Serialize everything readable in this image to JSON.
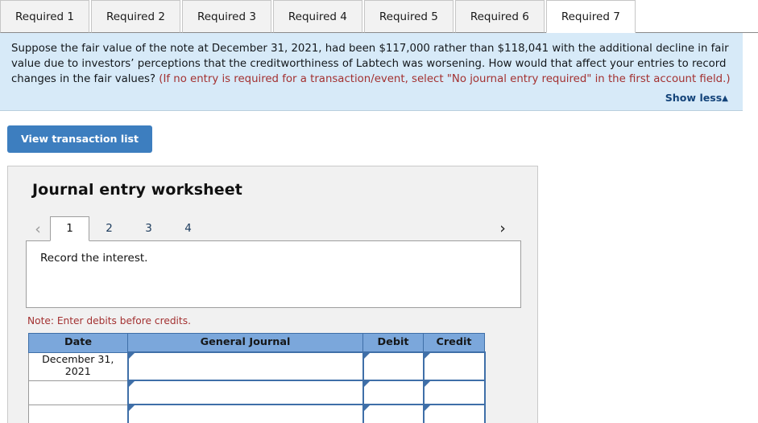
{
  "requirement_tabs": [
    {
      "label": "Required 1",
      "active": false
    },
    {
      "label": "Required 2",
      "active": false
    },
    {
      "label": "Required 3",
      "active": false
    },
    {
      "label": "Required 4",
      "active": false
    },
    {
      "label": "Required 5",
      "active": false
    },
    {
      "label": "Required 6",
      "active": false
    },
    {
      "label": "Required 7",
      "active": true
    }
  ],
  "question": {
    "body": "Suppose the fair value of the note at December 31, 2021, had been $117,000 rather than $118,041 with the additional decline in fair value due to investors’ perceptions that the creditworthiness of Labtech was worsening. How would that affect your entries to record changes in the fair values? ",
    "hint": "(If no entry is required for a transaction/event, select \"No journal entry required\" in the first account field.)",
    "show_less_label": "Show less",
    "show_less_caret": "▲"
  },
  "toolbar": {
    "view_transaction_list_label": "View transaction list"
  },
  "worksheet": {
    "title": "Journal entry worksheet",
    "pager": {
      "prev_icon": "‹",
      "next_icon": "›",
      "pages": [
        {
          "label": "1",
          "active": true
        },
        {
          "label": "2",
          "active": false
        },
        {
          "label": "3",
          "active": false
        },
        {
          "label": "4",
          "active": false
        }
      ]
    },
    "instruction": "Record the interest.",
    "note": "Note: Enter debits before credits.",
    "table": {
      "headers": [
        "Date",
        "General Journal",
        "Debit",
        "Credit"
      ],
      "rows": [
        {
          "date": "December 31, 2021",
          "general_journal": "",
          "debit": "",
          "credit": ""
        },
        {
          "date": "",
          "general_journal": "",
          "debit": "",
          "credit": ""
        },
        {
          "date": "",
          "general_journal": "",
          "debit": "",
          "credit": ""
        }
      ]
    }
  },
  "colors": {
    "question_panel_bg": "#d7eaf8",
    "hint_red": "#a33131",
    "button_blue": "#3d7ebf",
    "table_header_blue": "#7ba7db",
    "input_border_blue": "#3f6fa8",
    "link_blue": "#14447a"
  }
}
